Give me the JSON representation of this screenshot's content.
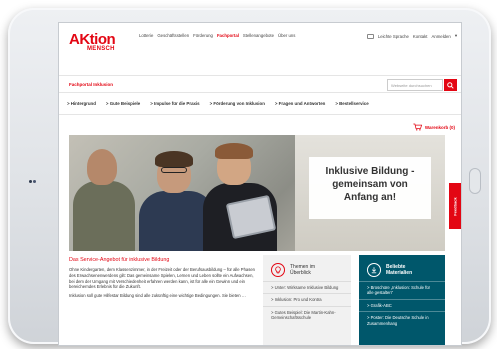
{
  "brand": {
    "name": "AKtion",
    "sub": "MENSCH"
  },
  "topnav": {
    "items": [
      "Lotterie",
      "Geschäftsstellen",
      "Förderung",
      "Fachportal",
      "Stellenangebote",
      "Über uns"
    ],
    "active_index": 3
  },
  "utility": {
    "links": [
      "Leichte Sprache",
      "Kontakt",
      "Anmelden"
    ]
  },
  "portal": {
    "title": "Fachportal Inklusion",
    "search_placeholder": "Webseite durchsuchen"
  },
  "mainnav": {
    "items": [
      "> Hintergrund",
      "> Gute Beispiele",
      "> Impulse für die Praxis",
      "> Förderung von Inklusion",
      "> Fragen und Antworten",
      "> Bestellservice"
    ]
  },
  "cart": {
    "label": "Warenkorb (0)"
  },
  "hero": {
    "headline_lines": [
      "Inklusive Bildung -",
      "gemeinsam von",
      "Anfang an!"
    ],
    "feedback_label": "Feedback"
  },
  "intro": {
    "heading": "Das Service-Angebot für inklusive Bildung",
    "paragraphs": [
      "Ohne Kindergarten, dem Klassenzimmer, in der Freizeit oder der Berufsausbildung – für alle Phasen des Erwachsenenwerdens gilt: Das gemeinsame Spielen, Lernen und Leben sollte ein Aufwachsen, bei dem der Umgang mit Verschiedenheit erfahren werden kann, ist für alle ein Gewinn und ein bereicherndes Erlebnis für die Zukunft.",
      "Inklusion soll gute Hilfestar Bildung sind alle zukünftig eine wichtige Bedingungen. Sie bieten …"
    ]
  },
  "themes": {
    "title_lines": [
      "Themen im",
      "Überblick"
    ],
    "items": [
      "> Unter: Wirksame Inklusive Bildung",
      "> Inklusion: Pro und Kontra",
      "> Gutes Beispiel: Die Martin-Kahn-Gemeinschaftsschule"
    ]
  },
  "materials": {
    "title_lines": [
      "Beliebte",
      "Materialien"
    ],
    "items": [
      "> Broschüre „Inklusion: Schule für alle gestalten“",
      "> Grafik-ABC",
      "> Poster: Die Deutsche Schule in Zusammenhang"
    ]
  },
  "colors": {
    "brand_red": "#e30613",
    "materials_bg": "#00576b"
  }
}
